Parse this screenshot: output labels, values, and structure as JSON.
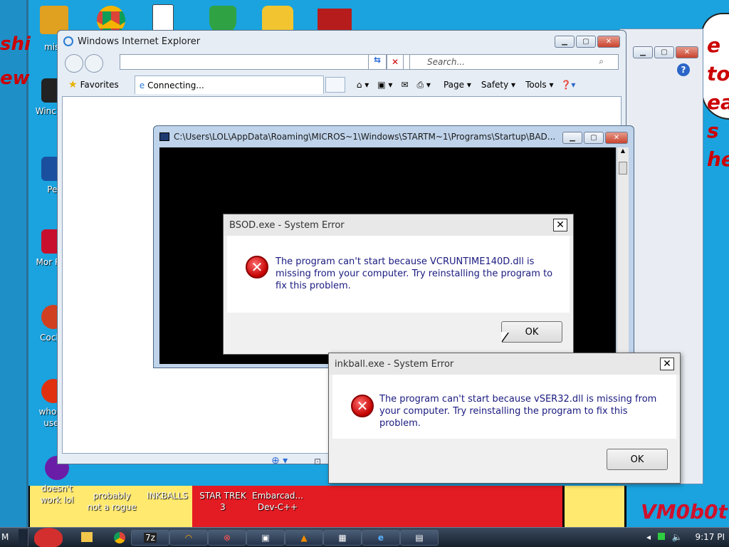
{
  "desktop": {
    "left_banner_text": [
      "shi",
      "ew"
    ],
    "right_banner_text": [
      "e to eat s",
      "he"
    ],
    "corner_tag": "VM0b0t",
    "icons_left": [
      {
        "label": "mist",
        "icon": "folder-icon",
        "color": "#e0a020"
      },
      {
        "label": "Winc Vis",
        "icon": "disk-icon",
        "color": "#222222"
      },
      {
        "label": "Pei",
        "icon": "p-app-icon",
        "color": "#1a4fa0"
      },
      {
        "label": "Mor Rea",
        "icon": "pdf-icon",
        "color": "#c8102e"
      },
      {
        "label": "CockC",
        "icon": "cockc-icon",
        "color": "#d04020"
      },
      {
        "label": "who th uses",
        "icon": "flash-icon",
        "color": "#e03010"
      },
      {
        "label": "doesn't work lol",
        "icon": "yahoo-icon",
        "color": "#6a1ea8"
      }
    ],
    "icons_top": [
      "computer-icon",
      "chrome-icon",
      "solitaire-icon",
      "shield-icon",
      "angry-birds-icon",
      "flag-icon"
    ],
    "icons_bottom": [
      {
        "label": "probably not a rogue"
      },
      {
        "label": "INKBALLS"
      },
      {
        "label": "STAR TREK 3"
      },
      {
        "label": "Embarcad... Dev-C++"
      }
    ]
  },
  "ie": {
    "title": "Windows Internet Explorer",
    "address_value": "",
    "search_placeholder": "Search...",
    "favorites_label": "Favorites",
    "tab_label": "Connecting...",
    "cmd": {
      "page": "Page ▾",
      "safety": "Safety ▾",
      "tools": "Tools ▾"
    },
    "colors": {
      "frame": "#dbe6f2"
    }
  },
  "console": {
    "title": "C:\\Users\\LOL\\AppData\\Roaming\\MICROS~1\\Windows\\STARTM~1\\Programs\\Startup\\BAD..."
  },
  "dialog_bsod": {
    "title": "BSOD.exe - System Error",
    "message": "The program can't start because VCRUNTIME140D.dll is missing from your computer. Try reinstalling the program to fix this problem.",
    "ok_label": "OK"
  },
  "dialog_inkball": {
    "title": "inkball.exe - System Error",
    "message": "The program can't start because vSER32.dll is missing from your computer. Try reinstalling the program to fix this problem.",
    "ok_label": "OK"
  },
  "taskbar": {
    "start_text": "M",
    "clock": "9:17 PI",
    "items": [
      "angry-birds-icon",
      "folder-icon",
      "chrome-icon",
      "7z-icon",
      "headphones-icon",
      "error-icon",
      "window-icon",
      "vlc-icon",
      "calculator-icon",
      "ie-icon",
      "cmd-icon"
    ]
  }
}
